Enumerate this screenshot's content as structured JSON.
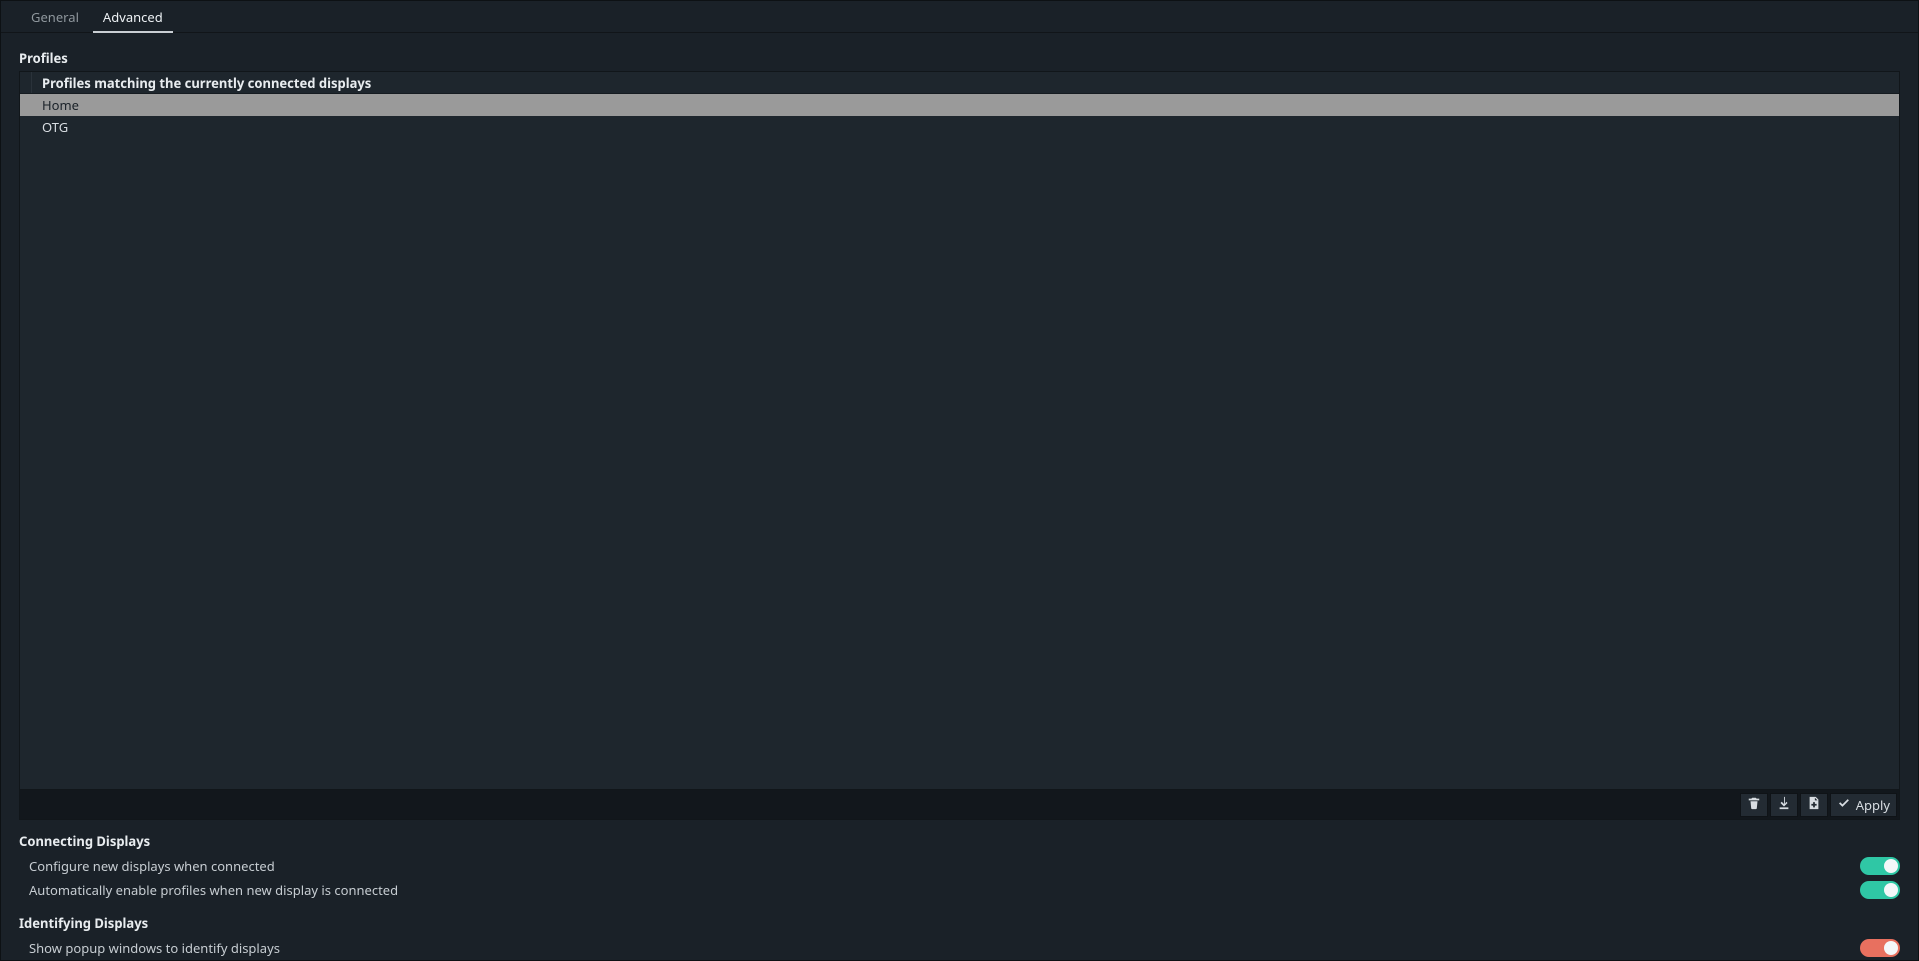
{
  "tabs": {
    "general": "General",
    "advanced": "Advanced",
    "active": "advanced"
  },
  "profiles": {
    "section_title": "Profiles",
    "column_header": "Profiles matching the currently connected displays",
    "items": [
      {
        "name": "Home",
        "selected": true
      },
      {
        "name": "OTG",
        "selected": false
      }
    ],
    "toolbar": {
      "apply_label": "Apply"
    }
  },
  "connecting": {
    "section_title": "Connecting Displays",
    "row0": {
      "label": "Configure new displays when connected",
      "on": true
    },
    "row1": {
      "label": "Automatically enable profiles when new display is connected",
      "on": true
    }
  },
  "identifying": {
    "section_title": "Identifying Displays",
    "row0": {
      "label": "Show popup windows to identify displays",
      "on": false
    }
  }
}
